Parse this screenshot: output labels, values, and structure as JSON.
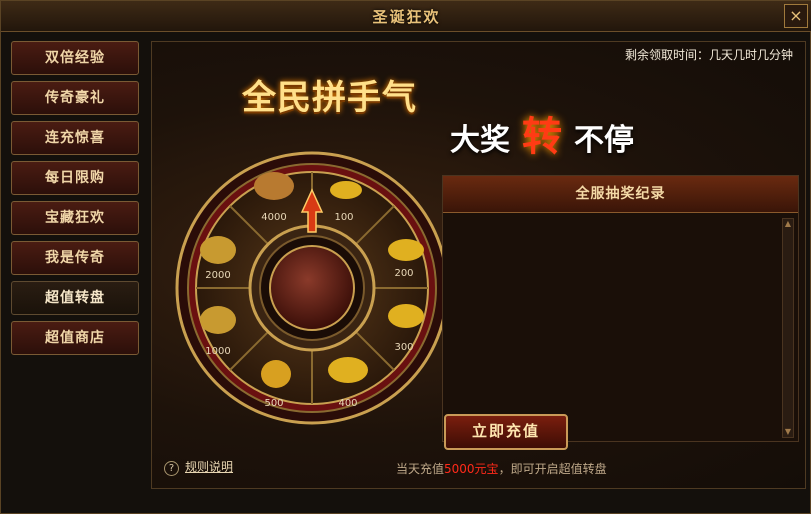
{
  "window": {
    "title": "圣诞狂欢",
    "close_label": "×"
  },
  "sidebar": {
    "items": [
      {
        "label": "双倍经验"
      },
      {
        "label": "传奇豪礼"
      },
      {
        "label": "连充惊喜"
      },
      {
        "label": "每日限购"
      },
      {
        "label": "宝藏狂欢"
      },
      {
        "label": "我是传奇"
      },
      {
        "label": "超值转盘",
        "active": true
      },
      {
        "label": "超值商店"
      }
    ]
  },
  "main": {
    "timer": "剩余领取时间：几天几时几分钟",
    "headline": "全民拼手气",
    "banner": {
      "pre": "大奖",
      "big": "转",
      "post": "不停"
    },
    "records_title": "全服抽奖纪录",
    "charge_button": "立即充值",
    "rules_link": "规则说明",
    "notice": {
      "pre": "当天充值",
      "highlight": "5000元宝",
      "post": "，即可开启超值转盘"
    }
  },
  "wheel": {
    "segments": [
      {
        "value": "4000",
        "icon": "treasure-bag-icon"
      },
      {
        "value": "100",
        "icon": "gold-ingot-icon"
      },
      {
        "value": "200",
        "icon": "gold-ingots-icon"
      },
      {
        "value": "300",
        "icon": "gold-ingots-icon"
      },
      {
        "value": "400",
        "icon": "gold-ingots-icon"
      },
      {
        "value": "500",
        "icon": "money-bag-icon"
      },
      {
        "value": "1000",
        "icon": "treasure-bag-icon"
      },
      {
        "value": "2000",
        "icon": "treasure-bag-icon"
      }
    ],
    "colors": {
      "rim": "#6a1010",
      "gold": "#c9a050",
      "segment": "#3a2412"
    }
  }
}
